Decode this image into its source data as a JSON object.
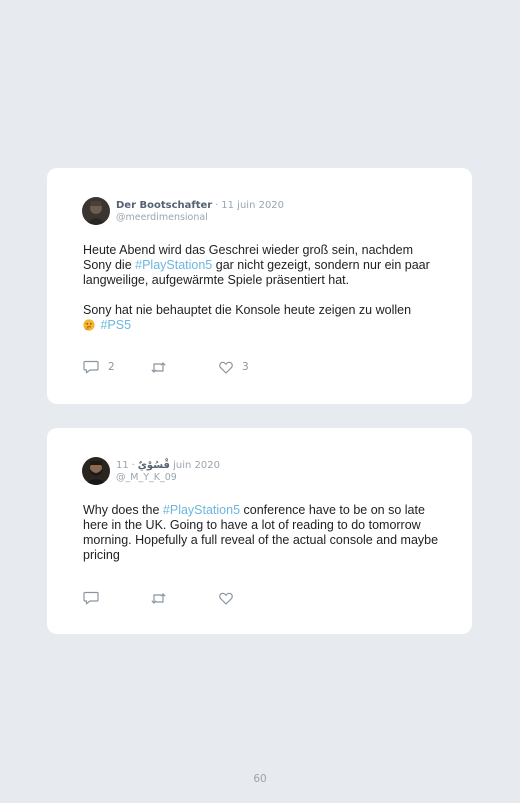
{
  "tweets": [
    {
      "display_name": "Der Bootschafter",
      "separator": "·",
      "date": "11 juin 2020",
      "handle": "@meerdimensional",
      "paragraph1": {
        "before": "Heute Abend wird das Geschrei wieder groß sein, nachdem Sony die ",
        "hashtag": "#PlayStation5",
        "after": " gar nicht gezeigt, sondern nur ein paar langweilige, aufgewärmte Spiele präsentiert hat."
      },
      "paragraph2": {
        "text": "Sony hat nie behauptet die Konsole heute zeigen zu wollen",
        "emoji": "thinking-face-emoji",
        "hashtag": "#PS5"
      },
      "reply_count": "2",
      "retweet_count": "",
      "like_count": "3"
    },
    {
      "display_name": "قْسُوْيٌ",
      "separator": "·",
      "date": "11 juin 2020",
      "handle": "@_M_Y_K_09",
      "paragraph1": {
        "before": "Why does the ",
        "hashtag": "#PlayStation5",
        "after": " conference have to be on so late here in the UK. Going to have a lot of reading to do tomorrow morning. Hopefully a full reveal of the actual console and maybe pricing"
      },
      "reply_count": "",
      "retweet_count": "",
      "like_count": ""
    }
  ],
  "icons": {
    "reply": "speech-bubble-icon",
    "retweet": "retweet-arrows-icon",
    "like": "heart-outline-icon"
  },
  "colors": {
    "background": "#e7eaee",
    "card": "#ffffff",
    "hashtag": "#6bb7df",
    "muted": "#9aa5af",
    "name": "#556270"
  },
  "page_number": "60"
}
